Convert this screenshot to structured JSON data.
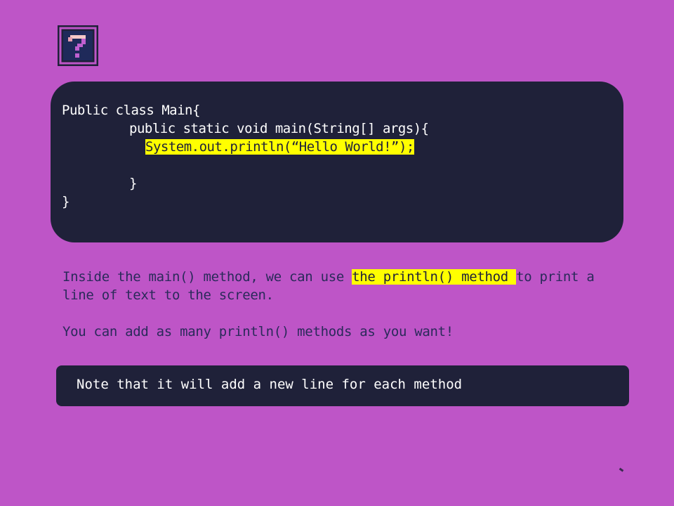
{
  "help_icon": "question-mark-icon",
  "code": {
    "lines": [
      "Public class Main{",
      "public static void main(String[] args){",
      "System.out.println(“Hello World!”);",
      "}",
      "}"
    ]
  },
  "explanation": {
    "p1_before": "Inside the main() method, we can use ",
    "p1_highlight": "the println() method ",
    "p1_after": "to print a line of text to the screen.",
    "p2": "You can add as many println() methods as you want!"
  },
  "note": "Note that it will add a new line for each method",
  "colors": {
    "background": "#be55c7",
    "panel": "#1f2139",
    "highlight": "#ffff00"
  }
}
